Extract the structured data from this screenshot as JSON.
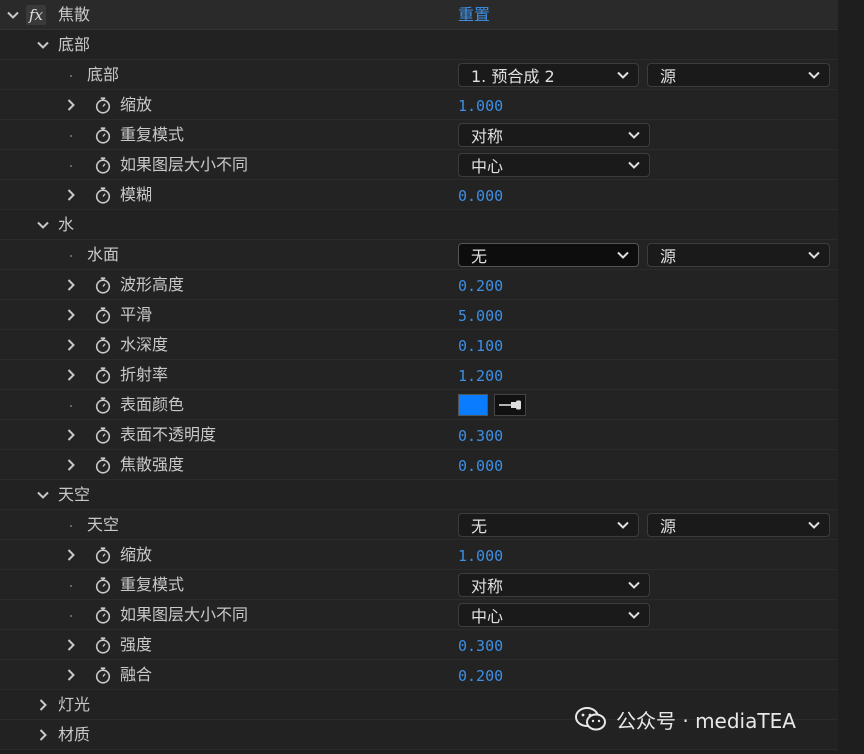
{
  "effect": {
    "name": "焦散",
    "fx": "fx",
    "reset": "重置"
  },
  "groups": {
    "bottom": {
      "title": "底部",
      "layer_label": "底部",
      "layer_value": "1. 预合成 2",
      "source_value": "源",
      "props": [
        {
          "label": "缩放",
          "value": "1.000"
        },
        {
          "label": "重复模式",
          "select": "对称"
        },
        {
          "label": "如果图层大小不同",
          "select": "中心"
        },
        {
          "label": "模糊",
          "value": "0.000"
        }
      ]
    },
    "water": {
      "title": "水",
      "layer_label": "水面",
      "layer_value": "无",
      "source_value": "源",
      "props": [
        {
          "label": "波形高度",
          "value": "0.200"
        },
        {
          "label": "平滑",
          "value": "5.000"
        },
        {
          "label": "水深度",
          "value": "0.100"
        },
        {
          "label": "折射率",
          "value": "1.200"
        },
        {
          "label": "表面颜色",
          "color": "#0a7cff"
        },
        {
          "label": "表面不透明度",
          "value": "0.300"
        },
        {
          "label": "焦散强度",
          "value": "0.000"
        }
      ]
    },
    "sky": {
      "title": "天空",
      "layer_label": "天空",
      "layer_value": "无",
      "source_value": "源",
      "props": [
        {
          "label": "缩放",
          "value": "1.000"
        },
        {
          "label": "重复模式",
          "select": "对称"
        },
        {
          "label": "如果图层大小不同",
          "select": "中心"
        },
        {
          "label": "强度",
          "value": "0.300"
        },
        {
          "label": "融合",
          "value": "0.200"
        }
      ]
    },
    "light": {
      "title": "灯光"
    },
    "material": {
      "title": "材质"
    }
  },
  "watermark": {
    "text": "公众号 · mediaTEA"
  },
  "colors": {
    "value_blue": "#3e8fe3",
    "surface_color": "#0a7cff"
  }
}
